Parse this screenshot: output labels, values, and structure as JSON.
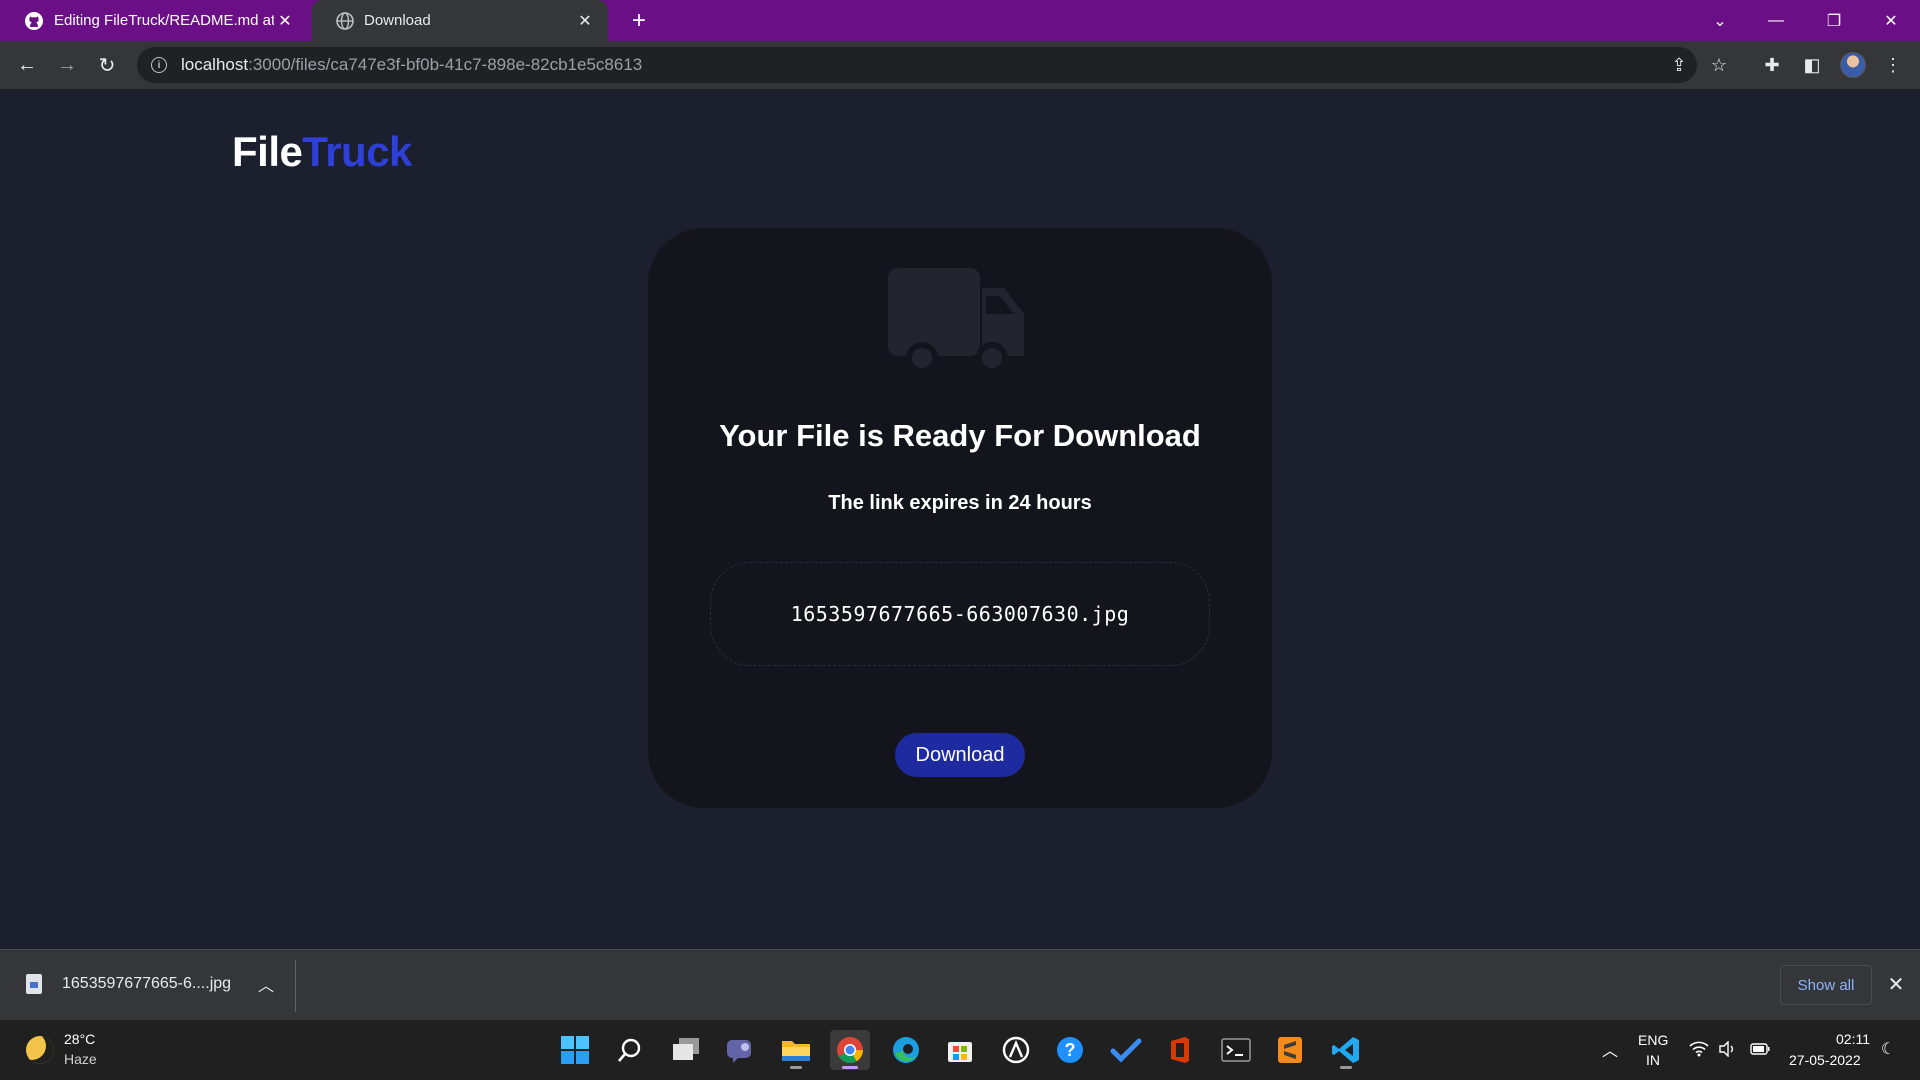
{
  "browser": {
    "tabs": [
      {
        "title": "Editing FileTruck/README.md at",
        "icon": "github-icon",
        "active": false
      },
      {
        "title": "Download",
        "icon": "globe-icon",
        "active": true
      }
    ],
    "url_host": "localhost",
    "url_rest": ":3000/files/ca747e3f-bf0b-41c7-898e-82cb1e5c8613"
  },
  "page": {
    "logo_part1": "File",
    "logo_part2": "Truck",
    "logo_color_accent": "#2f40d8",
    "card": {
      "icon": "truck-icon",
      "title": "Your File is Ready For Download",
      "subtitle": "The link expires in 24 hours",
      "filename": "1653597677665-663007630.jpg",
      "button_label": "Download",
      "button_color": "#1d2aa0"
    }
  },
  "download_shelf": {
    "file_label": "1653597677665-6....jpg",
    "show_all_label": "Show all"
  },
  "taskbar": {
    "weather_temp": "28°C",
    "weather_desc": "Haze",
    "apps": [
      "start",
      "search",
      "task-view",
      "teams-chat",
      "file-explorer",
      "chrome",
      "edge",
      "microsoft-store",
      "app",
      "get-help",
      "todo",
      "office",
      "terminal",
      "sublime-text",
      "vscode"
    ],
    "lang_line1": "ENG",
    "lang_line2": "IN",
    "time": "02:11",
    "date": "27-05-2022"
  }
}
